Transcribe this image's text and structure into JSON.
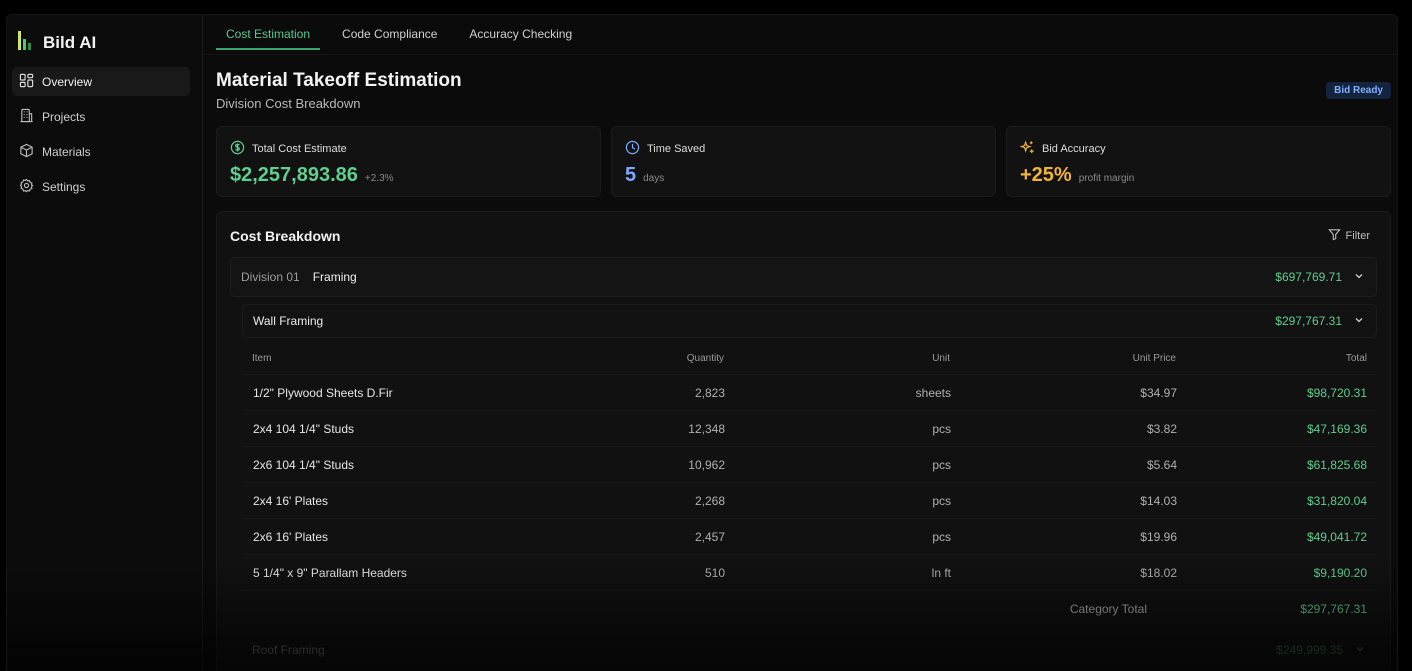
{
  "app": {
    "name": "Bild AI"
  },
  "sidebar": {
    "items": [
      {
        "label": "Overview",
        "icon": "layout-grid-icon",
        "active": true
      },
      {
        "label": "Projects",
        "icon": "building-icon"
      },
      {
        "label": "Materials",
        "icon": "box-icon"
      },
      {
        "label": "Settings",
        "icon": "gear-icon"
      }
    ]
  },
  "tabs": [
    {
      "label": "Cost Estimation",
      "active": true
    },
    {
      "label": "Code Compliance"
    },
    {
      "label": "Accuracy Checking"
    }
  ],
  "header": {
    "title": "Material Takeoff Estimation",
    "subtitle": "Division Cost Breakdown",
    "badge": "Bid Ready"
  },
  "cards": [
    {
      "label": "Total Cost Estimate",
      "icon": "dollar-circle-icon",
      "value": "$2,257,893.86",
      "sub": "+2.3%",
      "color": "#5fcf8f"
    },
    {
      "label": "Time Saved",
      "icon": "clock-icon",
      "value": "5",
      "sub": "days",
      "color": "#7fa9ff"
    },
    {
      "label": "Bid Accuracy",
      "icon": "sparkles-icon",
      "value": "+25%",
      "sub": "profit margin",
      "color": "#f0b43a"
    }
  ],
  "breakdown": {
    "title": "Cost Breakdown",
    "filter_label": "Filter",
    "division": {
      "number": "Division 01",
      "name": "Framing",
      "total": "$697,769.71"
    },
    "category": {
      "name": "Wall Framing",
      "total": "$297,767.31"
    },
    "columns": [
      "Item",
      "Quantity",
      "Unit",
      "Unit Price",
      "Total"
    ],
    "rows": [
      {
        "item": "1/2\" Plywood Sheets D.Fir",
        "quantity": "2,823",
        "unit": "sheets",
        "unit_price": "$34.97",
        "total": "$98,720.31"
      },
      {
        "item": "2x4 104 1/4\" Studs",
        "quantity": "12,348",
        "unit": "pcs",
        "unit_price": "$3.82",
        "total": "$47,169.36"
      },
      {
        "item": "2x6 104 1/4\" Studs",
        "quantity": "10,962",
        "unit": "pcs",
        "unit_price": "$5.64",
        "total": "$61,825.68"
      },
      {
        "item": "2x4 16' Plates",
        "quantity": "2,268",
        "unit": "pcs",
        "unit_price": "$14.03",
        "total": "$31,820.04"
      },
      {
        "item": "2x6 16' Plates",
        "quantity": "2,457",
        "unit": "pcs",
        "unit_price": "$19.96",
        "total": "$49,041.72"
      },
      {
        "item": "5 1/4\" x 9\" Parallam Headers",
        "quantity": "510",
        "unit": "ln ft",
        "unit_price": "$18.02",
        "total": "$9,190.20"
      }
    ],
    "category_total_label": "Category Total",
    "category_total": "$297,767.31",
    "next_category": {
      "name": "Roof Framing",
      "total": "$249,999.35"
    }
  },
  "colors": {
    "accent": "#5fcf8f",
    "badge_bg": "#14243f",
    "badge_text": "#7fb0ff"
  }
}
